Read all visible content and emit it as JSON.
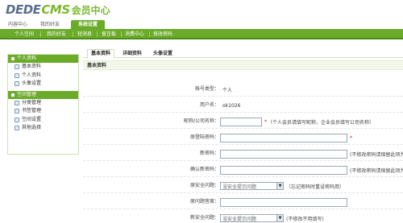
{
  "logo": {
    "dede": "DEDE",
    "cms": "CMS",
    "center": "会员中心"
  },
  "top_tabs": [
    {
      "label": "内容中心",
      "active": false
    },
    {
      "label": "我的好友",
      "active": false
    },
    {
      "label": "系统设置",
      "active": true
    }
  ],
  "nav": [
    {
      "label": "个人空间"
    },
    {
      "label": "我的好友"
    },
    {
      "label": "短消息"
    },
    {
      "label": "留言板"
    },
    {
      "label": "消费中心"
    },
    {
      "label": "修改密码"
    }
  ],
  "sidebar": {
    "personal_head": "个人资料",
    "personal_items": [
      "基本资料",
      "个人资料",
      "头像设置"
    ],
    "space_head": "空间管理",
    "space_items": [
      "分类管理",
      "书签管理",
      "空间设置",
      "其他选择"
    ]
  },
  "tabs": [
    {
      "label": "基本资料",
      "active": true
    },
    {
      "label": "详细资料",
      "active": false
    },
    {
      "label": "头像设置",
      "active": false
    }
  ],
  "section_title": "基本资料",
  "form": {
    "account_type_label": "帐号类型：",
    "account_type_value": "个人",
    "username_label": "用户名：",
    "username_value": "ok1026",
    "nickname_label": "昵称/公司名称：",
    "nickname_value": "",
    "nickname_note": "（个人会员请填写昵称，企业会员填写公司名称）",
    "orig_password_label": "原登陆密码：",
    "new_password_label": "新密码：",
    "new_password_note": "(不修改密码请保留此项为空)",
    "confirm_password_label": "确认新密码：",
    "confirm_password_note": "(不修改密码请保留此项为空)",
    "orig_question_label": "原安全问题：",
    "orig_question_select": "没安全提示问题",
    "orig_question_note": "（忘记密码时重设密码用）",
    "orig_answer_label": "原问题答案：",
    "new_question_label": "新安全问题：",
    "new_question_select": "没安全提示问题",
    "new_question_note": "(不修改不用填写)"
  },
  "colors": {
    "brand_green": "#6aab2a",
    "logo_blue": "#5a6e8c",
    "required_red": "#dd0000"
  }
}
